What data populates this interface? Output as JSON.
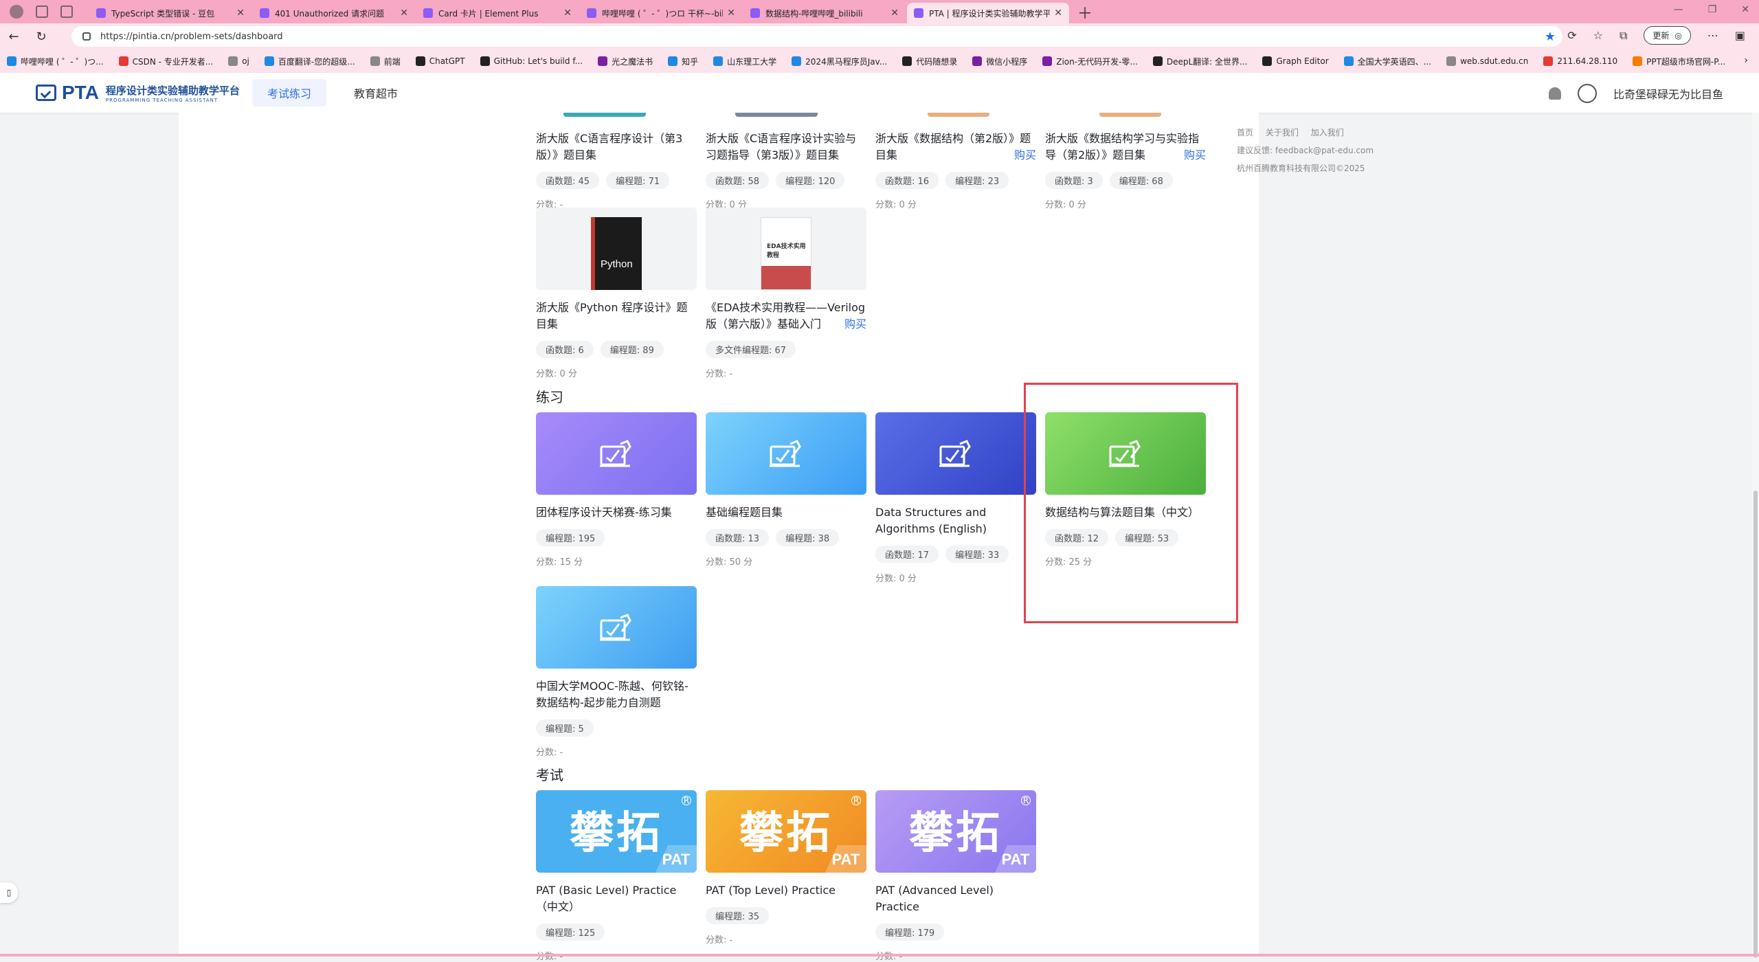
{
  "browser": {
    "tabs": [
      {
        "title": "TypeScript 类型错误 - 豆包",
        "active": false
      },
      {
        "title": "401 Unauthorized 请求问题",
        "active": false
      },
      {
        "title": "Card 卡片 | Element Plus",
        "active": false
      },
      {
        "title": "哔哩哔哩 ( ゜- ゜)つロ 干杯~-bilibili",
        "active": false
      },
      {
        "title": "数据结构-哔哩哔哩_bilibili",
        "active": false
      },
      {
        "title": "PTA | 程序设计类实验辅助教学平台",
        "active": true
      }
    ],
    "url": "https://pintia.cn/problem-sets/dashboard",
    "update_label": "更新",
    "bookmarks": [
      "哔哩哔哩 ( ゜- ゜)つ...",
      "CSDN - 专业开发者...",
      "oj",
      "百度翻译-您的超级...",
      "前端",
      "ChatGPT",
      "GitHub: Let's build f...",
      "光之魔法书",
      "知乎",
      "山东理工大学",
      "2024黑马程序员Jav...",
      "代码随想录",
      "微信小程序",
      "Zion-无代码开发-零...",
      "DeepL翻译: 全世界...",
      "Graph Editor",
      "全国大学英语四、...",
      "web.sdut.edu.cn",
      "211.64.28.110",
      "PPT超级市场官网-P..."
    ]
  },
  "header": {
    "logo_main": "PTA",
    "logo_cn": "程序设计类实验辅助教学平台",
    "logo_en": "PROGRAMMING TEACHING ASSISTANT",
    "nav": [
      "考试练习",
      "教育超市"
    ],
    "username": "比奇堡碌碌无为比目鱼"
  },
  "footer": {
    "links": [
      "首页",
      "关于我们",
      "加入我们"
    ],
    "feedback": "建议反馈: feedback@pat-edu.com",
    "copyright": "杭州百腾教育科技有限公司©2025"
  },
  "textbooks_row1": [
    {
      "title": "浙大版《C语言程序设计（第3版）》题目集",
      "buy": "",
      "tags": [
        "函数题: 45",
        "编程题: 71"
      ],
      "score": "分数: -"
    },
    {
      "title": "浙大版《C语言程序设计实验与习题指导（第3版）》题目集",
      "buy": "",
      "tags": [
        "函数题: 58",
        "编程题: 120"
      ],
      "score": "分数: 0 分"
    },
    {
      "title": "浙大版《数据结构（第2版）》题目集",
      "buy": "购买",
      "tags": [
        "函数题: 16",
        "编程题: 23"
      ],
      "score": "分数: 0 分"
    },
    {
      "title": "浙大版《数据结构学习与实验指导（第2版）》题目集",
      "buy": "购买",
      "tags": [
        "函数题: 3",
        "编程题: 68"
      ],
      "score": "分数: 0 分"
    }
  ],
  "textbooks_row2": [
    {
      "title": "浙大版《Python 程序设计》题目集",
      "buy": "",
      "tags": [
        "函数题: 6",
        "编程题: 89"
      ],
      "score": "分数: 0 分",
      "book_title": "Python"
    },
    {
      "title": "《EDA技术实用教程——Verilog版（第六版）》基础入门",
      "buy": "购买",
      "tags": [
        "多文件编程题: 67"
      ],
      "score": "分数: -",
      "book_title": "EDA技术实用教程"
    }
  ],
  "practice": {
    "section_title": "练习",
    "cards": [
      {
        "title": "团体程序设计天梯赛-练习集",
        "tags": [
          "编程题: 195"
        ],
        "score": "分数: 15 分"
      },
      {
        "title": "基础编程题目集",
        "tags": [
          "函数题: 13",
          "编程题: 38"
        ],
        "score": "分数: 50 分"
      },
      {
        "title": "Data Structures and Algorithms (English)",
        "tags": [
          "函数题: 17",
          "编程题: 33"
        ],
        "score": "分数: 0 分"
      },
      {
        "title": "数据结构与算法题目集（中文）",
        "tags": [
          "函数题: 12",
          "编程题: 53"
        ],
        "score": "分数: 25 分"
      },
      {
        "title": "中国大学MOOC-陈越、何钦铭-数据结构-起步能力自测题",
        "tags": [
          "编程题: 5"
        ],
        "score": "分数: -"
      }
    ]
  },
  "exams": {
    "section_title": "考试",
    "cover_text": "攀拓",
    "badge": "PAT",
    "cards": [
      {
        "title": "PAT (Basic Level) Practice （中文）",
        "tags": [
          "编程题: 125"
        ],
        "score": "分数: -"
      },
      {
        "title": "PAT (Top Level) Practice",
        "tags": [
          "编程题: 35"
        ],
        "score": "分数: -"
      },
      {
        "title": "PAT (Advanced Level) Practice",
        "tags": [
          "编程题: 179"
        ],
        "score": "分数: -"
      }
    ]
  },
  "colors": {
    "accent": "#2f6fe3",
    "highlight": "#e4424e"
  }
}
